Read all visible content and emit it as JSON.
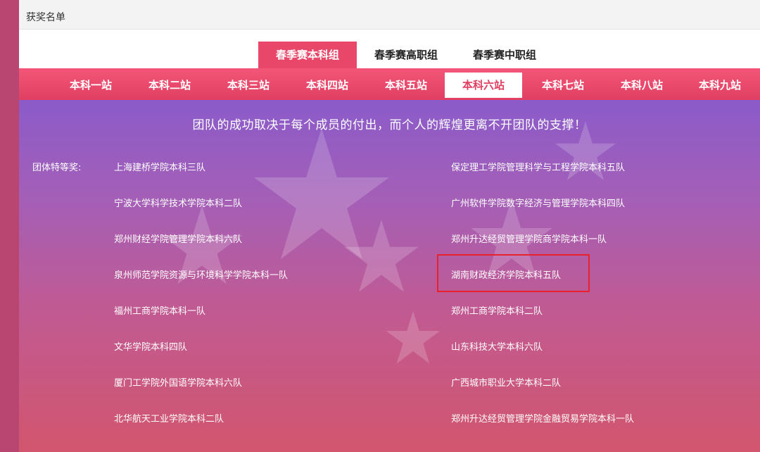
{
  "header": {
    "title": "获奖名单"
  },
  "groups": [
    {
      "label": "春季赛本科组",
      "active": true
    },
    {
      "label": "春季赛高职组",
      "active": false
    },
    {
      "label": "春季赛中职组",
      "active": false
    }
  ],
  "stations": [
    {
      "label": "本科一站",
      "active": false
    },
    {
      "label": "本科二站",
      "active": false
    },
    {
      "label": "本科三站",
      "active": false
    },
    {
      "label": "本科四站",
      "active": false
    },
    {
      "label": "本科五站",
      "active": false
    },
    {
      "label": "本科六站",
      "active": true
    },
    {
      "label": "本科七站",
      "active": false
    },
    {
      "label": "本科八站",
      "active": false
    },
    {
      "label": "本科九站",
      "active": false
    }
  ],
  "slogan": "团队的成功取决于每个成员的付出，而个人的辉煌更离不开团队的支撑！",
  "award": {
    "label": "团体特等奖:",
    "left_column": [
      "上海建桥学院本科三队",
      "宁波大学科学技术学院本科二队",
      "郑州财经学院管理学院本科六队",
      "泉州师范学院资源与环境科学学院本科一队",
      "福州工商学院本科一队",
      "文华学院本科四队",
      "厦门工学院外国语学院本科六队",
      "北华航天工业学院本科二队"
    ],
    "right_column": [
      "保定理工学院管理科学与工程学院本科五队",
      "广州软件学院数字经济与管理学院本科四队",
      "郑州升达经贸管理学院商学院本科一队",
      "湖南财政经济学院本科五队",
      "郑州工商学院本科二队",
      "山东科技大学本科六队",
      "广西城市职业大学本科二队",
      "郑州升达经贸管理学院金融贸易学院本科一队"
    ],
    "highlighted": "湖南财政经济学院本科五队"
  },
  "colors": {
    "accent": "#e8476a",
    "highlight_border": "#e8212e"
  }
}
